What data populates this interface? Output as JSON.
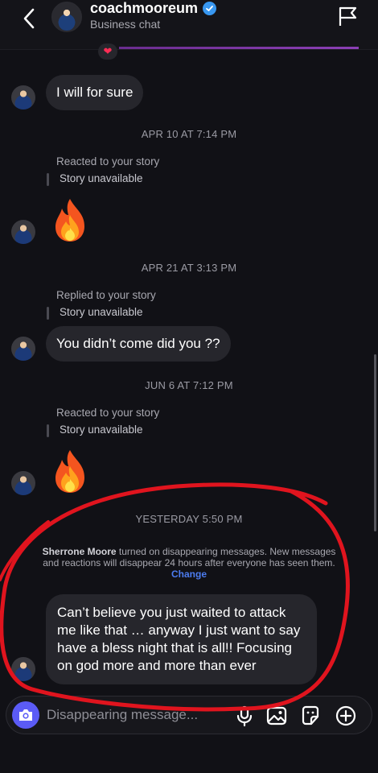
{
  "header": {
    "username": "coachmooreum",
    "subtitle": "Business chat",
    "back_icon": "chevron-left-icon",
    "flag_icon": "flag-icon",
    "verified_icon": "verified-badge-icon"
  },
  "messages": {
    "msg1": "I will for sure",
    "ts1": "APR 10 AT 7:14 PM",
    "note1": "Reacted to your story",
    "unavail1": "Story unavailable",
    "ts2": "APR 21 AT 3:13 PM",
    "note2": "Replied to your story",
    "unavail2": "Story unavailable",
    "msg2": "You didn’t come did you ??",
    "ts3": "JUN 6 AT 7:12 PM",
    "note3": "Reacted to your story",
    "unavail3": "Story unavailable",
    "ts4": "YESTERDAY 5:50 PM",
    "system_name": "Sherrone Moore",
    "system_text": " turned on disappearing messages. New messages and reactions will disappear 24 hours after everyone has seen them. ",
    "system_link": "Change",
    "msg3_line1": "Can’t believe you just waited to attack",
    "msg3_line2": "me like that … anyway I just want to say",
    "msg3_line3": "have a bless night that is all!! Focusing",
    "msg3_line4": "on god more and more than ever"
  },
  "composer": {
    "placeholder": "Disappearing message...",
    "icons": [
      "camera-icon",
      "microphone-icon",
      "gallery-icon",
      "sticker-icon",
      "plus-icon"
    ]
  },
  "colors": {
    "background": "#111116",
    "bubble": "#26262c",
    "accent": "#5b5bf6",
    "link": "#4c7cf0",
    "annotation": "#e0141e"
  }
}
